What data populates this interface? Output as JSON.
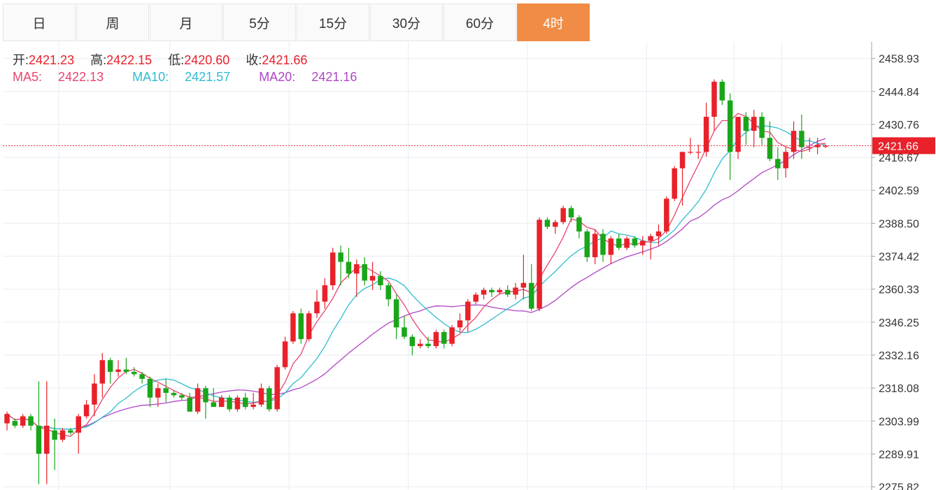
{
  "tabs": [
    {
      "label": "日",
      "active": false
    },
    {
      "label": "周",
      "active": false
    },
    {
      "label": "月",
      "active": false
    },
    {
      "label": "5分",
      "active": false
    },
    {
      "label": "15分",
      "active": false
    },
    {
      "label": "30分",
      "active": false
    },
    {
      "label": "60分",
      "active": false
    },
    {
      "label": "4时",
      "active": true
    }
  ],
  "ohlc": {
    "open_label": "开:",
    "open": "2421.23",
    "high_label": "高:",
    "high": "2422.15",
    "low_label": "低:",
    "low": "2420.60",
    "close_label": "收:",
    "close": "2421.66"
  },
  "ma": {
    "ma5_label": "MA5:",
    "ma5": "2422.13",
    "ma10_label": "MA10:",
    "ma10": "2421.57",
    "ma20_label": "MA20:",
    "ma20": "2421.16"
  },
  "colors": {
    "up": "#e8212a",
    "down": "#19a619",
    "ma5": "#e8466f",
    "ma10": "#2fbdce",
    "ma20": "#b046c4",
    "last_price": "#e8212a",
    "active_tab": "#f08c45"
  },
  "chart_data": {
    "type": "candlestick",
    "y_ticks": [
      "2458.93",
      "2444.84",
      "2430.76",
      "2416.67",
      "2402.59",
      "2388.50",
      "2374.42",
      "2360.33",
      "2346.25",
      "2332.16",
      "2318.08",
      "2303.99",
      "2289.91",
      "2275.82"
    ],
    "ylim": [
      2274.5,
      2466
    ],
    "last_price": 2421.66,
    "last_price_label": "2421.66",
    "candles": [
      [
        2303,
        2308,
        2300,
        2307
      ],
      [
        2304,
        2305,
        2301,
        2302
      ],
      [
        2302,
        2307,
        2301,
        2306
      ],
      [
        2306,
        2307,
        2300,
        2302
      ],
      [
        2302,
        2321,
        2277,
        2290
      ],
      [
        2290,
        2321,
        2277,
        2302
      ],
      [
        2300,
        2305,
        2283,
        2296
      ],
      [
        2296,
        2301,
        2295,
        2300
      ],
      [
        2300,
        2301,
        2298,
        2299
      ],
      [
        2299,
        2307,
        2290,
        2306
      ],
      [
        2306,
        2313,
        2305,
        2311
      ],
      [
        2311,
        2324,
        2306,
        2320
      ],
      [
        2320,
        2333,
        2314,
        2330
      ],
      [
        2330,
        2331,
        2320,
        2325
      ],
      [
        2325,
        2330,
        2323,
        2326
      ],
      [
        2326,
        2331,
        2324,
        2325
      ],
      [
        2325,
        2327,
        2323,
        2324
      ],
      [
        2324,
        2325,
        2320,
        2322
      ],
      [
        2322,
        2323,
        2310,
        2314
      ],
      [
        2314,
        2320,
        2310,
        2318
      ],
      [
        2318,
        2322,
        2312,
        2316
      ],
      [
        2316,
        2317,
        2314,
        2315
      ],
      [
        2315,
        2316,
        2313,
        2314
      ],
      [
        2314,
        2316,
        2308,
        2308
      ],
      [
        2308,
        2320,
        2307,
        2318
      ],
      [
        2318,
        2319,
        2305,
        2312
      ],
      [
        2312,
        2318,
        2310,
        2310
      ],
      [
        2310,
        2315,
        2310,
        2314
      ],
      [
        2314,
        2315,
        2308,
        2309
      ],
      [
        2309,
        2315,
        2308,
        2314
      ],
      [
        2314,
        2316,
        2309,
        2310
      ],
      [
        2310,
        2316,
        2309,
        2311
      ],
      [
        2311,
        2320,
        2310,
        2318
      ],
      [
        2318,
        2319,
        2308,
        2309
      ],
      [
        2309,
        2328,
        2308,
        2327
      ],
      [
        2327,
        2340,
        2326,
        2338
      ],
      [
        2338,
        2351,
        2337,
        2350
      ],
      [
        2350,
        2352,
        2337,
        2339
      ],
      [
        2339,
        2351,
        2338,
        2350
      ],
      [
        2350,
        2360,
        2348,
        2355
      ],
      [
        2355,
        2365,
        2352,
        2362
      ],
      [
        2362,
        2378,
        2360,
        2376
      ],
      [
        2376,
        2379,
        2362,
        2372
      ],
      [
        2372,
        2378,
        2365,
        2367
      ],
      [
        2367,
        2373,
        2357,
        2371
      ],
      [
        2371,
        2374,
        2362,
        2364
      ],
      [
        2364,
        2372,
        2360,
        2366
      ],
      [
        2366,
        2368,
        2360,
        2362
      ],
      [
        2362,
        2363,
        2353,
        2356
      ],
      [
        2356,
        2358,
        2339,
        2344
      ],
      [
        2344,
        2349,
        2339,
        2340
      ],
      [
        2340,
        2341,
        2332,
        2336
      ],
      [
        2336,
        2339,
        2335,
        2337
      ],
      [
        2337,
        2340,
        2335,
        2336
      ],
      [
        2336,
        2343,
        2335,
        2342
      ],
      [
        2342,
        2343,
        2335,
        2337
      ],
      [
        2337,
        2345,
        2336,
        2344
      ],
      [
        2344,
        2350,
        2342,
        2347
      ],
      [
        2347,
        2356,
        2342,
        2355
      ],
      [
        2355,
        2359,
        2354,
        2358
      ],
      [
        2358,
        2361,
        2356,
        2360
      ],
      [
        2360,
        2361,
        2357,
        2359
      ],
      [
        2359,
        2361,
        2358,
        2360
      ],
      [
        2360,
        2362,
        2357,
        2358
      ],
      [
        2358,
        2363,
        2356,
        2361
      ],
      [
        2361,
        2375,
        2356,
        2363
      ],
      [
        2363,
        2371,
        2351,
        2352
      ],
      [
        2352,
        2391,
        2351,
        2390
      ],
      [
        2390,
        2391,
        2386,
        2387
      ],
      [
        2387,
        2390,
        2384,
        2389
      ],
      [
        2389,
        2396,
        2388,
        2395
      ],
      [
        2395,
        2396,
        2389,
        2391
      ],
      [
        2391,
        2392,
        2382,
        2385
      ],
      [
        2385,
        2386,
        2372,
        2374
      ],
      [
        2374,
        2386,
        2371,
        2384
      ],
      [
        2384,
        2386,
        2372,
        2375
      ],
      [
        2375,
        2383,
        2371,
        2382
      ],
      [
        2382,
        2384,
        2377,
        2378
      ],
      [
        2378,
        2383,
        2377,
        2382
      ],
      [
        2382,
        2383,
        2378,
        2379
      ],
      [
        2379,
        2383,
        2375,
        2381
      ],
      [
        2381,
        2384,
        2373,
        2383
      ],
      [
        2383,
        2388,
        2379,
        2385
      ],
      [
        2385,
        2400,
        2384,
        2399
      ],
      [
        2399,
        2413,
        2398,
        2412
      ],
      [
        2412,
        2419,
        2396,
        2419
      ],
      [
        2419,
        2425,
        2418,
        2419
      ],
      [
        2419,
        2422,
        2416,
        2419
      ],
      [
        2419,
        2440,
        2417,
        2434
      ],
      [
        2434,
        2450,
        2428,
        2449
      ],
      [
        2449,
        2450,
        2439,
        2441
      ],
      [
        2441,
        2444,
        2407,
        2419
      ],
      [
        2419,
        2431,
        2416,
        2434
      ],
      [
        2434,
        2436,
        2422,
        2428
      ],
      [
        2428,
        2437,
        2421,
        2434
      ],
      [
        2434,
        2436,
        2422,
        2425
      ],
      [
        2425,
        2432,
        2415,
        2416
      ],
      [
        2416,
        2421,
        2407,
        2412
      ],
      [
        2412,
        2421,
        2408,
        2419
      ],
      [
        2419,
        2432,
        2416,
        2428
      ],
      [
        2428,
        2435,
        2416,
        2421
      ],
      [
        2421,
        2425,
        2419,
        2421
      ],
      [
        2421,
        2425,
        2418,
        2422
      ],
      [
        2421.23,
        2422.15,
        2420.6,
        2421.66
      ]
    ]
  }
}
